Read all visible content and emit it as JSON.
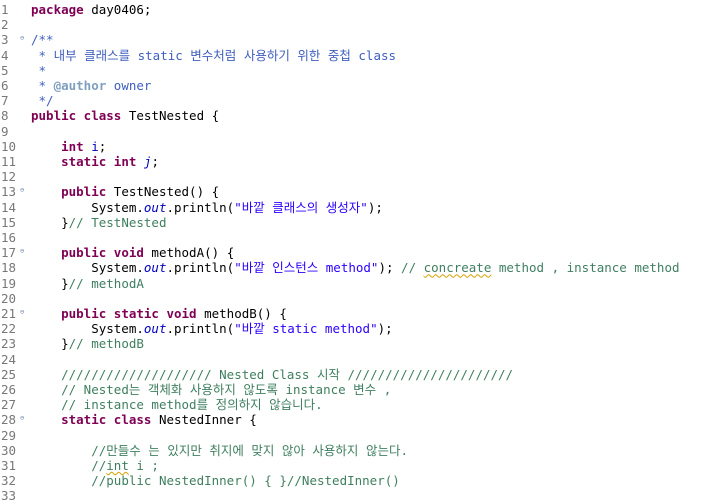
{
  "editor": {
    "language": "java",
    "colors": {
      "keyword": "#7f0055",
      "string": "#2a00ff",
      "comment": "#3f7f5f",
      "javadoc": "#3f5fbf",
      "javadoc_tag": "#7f9fbf",
      "field": "#0000c0",
      "line_number": "#787878"
    },
    "lines": [
      {
        "n": "1",
        "tokens": [
          {
            "t": "kw",
            "v": "package"
          },
          {
            "t": "",
            "v": " day0406;"
          }
        ]
      },
      {
        "n": "2",
        "tokens": []
      },
      {
        "n": "3",
        "fold": true,
        "tokens": [
          {
            "t": "jd",
            "v": "/**"
          }
        ]
      },
      {
        "n": "4",
        "tokens": [
          {
            "t": "jd",
            "v": " * 내부 클래스를 static 변수처럼 사용하기 위한 중첩 class"
          }
        ]
      },
      {
        "n": "5",
        "tokens": [
          {
            "t": "jd",
            "v": " *"
          }
        ]
      },
      {
        "n": "6",
        "tokens": [
          {
            "t": "jd",
            "v": " * "
          },
          {
            "t": "tag",
            "v": "@author"
          },
          {
            "t": "jd",
            "v": " owner"
          }
        ]
      },
      {
        "n": "7",
        "tokens": [
          {
            "t": "jd",
            "v": " */"
          }
        ]
      },
      {
        "n": "8",
        "tokens": [
          {
            "t": "kw",
            "v": "public class"
          },
          {
            "t": "",
            "v": " TestNested {"
          }
        ]
      },
      {
        "n": "9",
        "tokens": []
      },
      {
        "n": "10",
        "tokens": [
          {
            "t": "",
            "v": "    "
          },
          {
            "t": "kw",
            "v": "int"
          },
          {
            "t": "",
            "v": " "
          },
          {
            "t": "fld",
            "v": "i"
          },
          {
            "t": "",
            "v": ";"
          }
        ]
      },
      {
        "n": "11",
        "tokens": [
          {
            "t": "",
            "v": "    "
          },
          {
            "t": "kw",
            "v": "static int"
          },
          {
            "t": "",
            "v": " "
          },
          {
            "t": "fld st",
            "v": "j"
          },
          {
            "t": "",
            "v": ";"
          }
        ]
      },
      {
        "n": "12",
        "tokens": []
      },
      {
        "n": "13",
        "fold": true,
        "tokens": [
          {
            "t": "",
            "v": "    "
          },
          {
            "t": "kw",
            "v": "public"
          },
          {
            "t": "",
            "v": " TestNested() {"
          }
        ]
      },
      {
        "n": "14",
        "tokens": [
          {
            "t": "",
            "v": "        System."
          },
          {
            "t": "fld st",
            "v": "out"
          },
          {
            "t": "",
            "v": ".println("
          },
          {
            "t": "str",
            "v": "\"바깥 클래스의 생성자\""
          },
          {
            "t": "",
            "v": ");"
          }
        ]
      },
      {
        "n": "15",
        "tokens": [
          {
            "t": "",
            "v": "    }"
          },
          {
            "t": "cm",
            "v": "// TestNested"
          }
        ]
      },
      {
        "n": "16",
        "tokens": []
      },
      {
        "n": "17",
        "fold": true,
        "tokens": [
          {
            "t": "",
            "v": "    "
          },
          {
            "t": "kw",
            "v": "public void"
          },
          {
            "t": "",
            "v": " methodA() {"
          }
        ]
      },
      {
        "n": "18",
        "tokens": [
          {
            "t": "",
            "v": "        System."
          },
          {
            "t": "fld st",
            "v": "out"
          },
          {
            "t": "",
            "v": ".println("
          },
          {
            "t": "str",
            "v": "\"바깥 인스턴스 method\""
          },
          {
            "t": "",
            "v": "); "
          },
          {
            "t": "cm",
            "v": "// "
          },
          {
            "t": "cm sq",
            "v": "concreate"
          },
          {
            "t": "cm",
            "v": " method , instance method"
          }
        ]
      },
      {
        "n": "19",
        "tokens": [
          {
            "t": "",
            "v": "    }"
          },
          {
            "t": "cm",
            "v": "// methodA"
          }
        ]
      },
      {
        "n": "20",
        "tokens": []
      },
      {
        "n": "21",
        "fold": true,
        "tokens": [
          {
            "t": "",
            "v": "    "
          },
          {
            "t": "kw",
            "v": "public static void"
          },
          {
            "t": "",
            "v": " methodB() {"
          }
        ]
      },
      {
        "n": "22",
        "tokens": [
          {
            "t": "",
            "v": "        System."
          },
          {
            "t": "fld st",
            "v": "out"
          },
          {
            "t": "",
            "v": ".println("
          },
          {
            "t": "str",
            "v": "\"바깥 static method\""
          },
          {
            "t": "",
            "v": ");"
          }
        ]
      },
      {
        "n": "23",
        "tokens": [
          {
            "t": "",
            "v": "    }"
          },
          {
            "t": "cm",
            "v": "// methodB"
          }
        ]
      },
      {
        "n": "24",
        "tokens": []
      },
      {
        "n": "25",
        "tokens": [
          {
            "t": "",
            "v": "    "
          },
          {
            "t": "cm",
            "v": "//////////////////// Nested Class 시작 //////////////////////"
          }
        ]
      },
      {
        "n": "26",
        "tokens": [
          {
            "t": "",
            "v": "    "
          },
          {
            "t": "cm",
            "v": "// Nested는 객체화 사용하지 않도록 instance 변수 ,"
          }
        ]
      },
      {
        "n": "27",
        "tokens": [
          {
            "t": "",
            "v": "    "
          },
          {
            "t": "cm",
            "v": "// instance method를 정의하지 않습니다."
          }
        ]
      },
      {
        "n": "28",
        "fold": true,
        "tokens": [
          {
            "t": "",
            "v": "    "
          },
          {
            "t": "kw",
            "v": "static class"
          },
          {
            "t": "",
            "v": " NestedInner {"
          }
        ]
      },
      {
        "n": "29",
        "tokens": []
      },
      {
        "n": "30",
        "tokens": [
          {
            "t": "",
            "v": "        "
          },
          {
            "t": "cm",
            "v": "//만들수 는 있지만 취지에 맞지 않아 사용하지 않는다."
          }
        ]
      },
      {
        "n": "31",
        "tokens": [
          {
            "t": "",
            "v": "        "
          },
          {
            "t": "cm",
            "v": "//"
          },
          {
            "t": "cm sq",
            "v": "int"
          },
          {
            "t": "cm",
            "v": " i ;"
          }
        ]
      },
      {
        "n": "32",
        "tokens": [
          {
            "t": "",
            "v": "        "
          },
          {
            "t": "cm",
            "v": "//public NestedInner() { }//NestedInner()"
          }
        ]
      },
      {
        "n": "33",
        "tokens": []
      }
    ]
  }
}
